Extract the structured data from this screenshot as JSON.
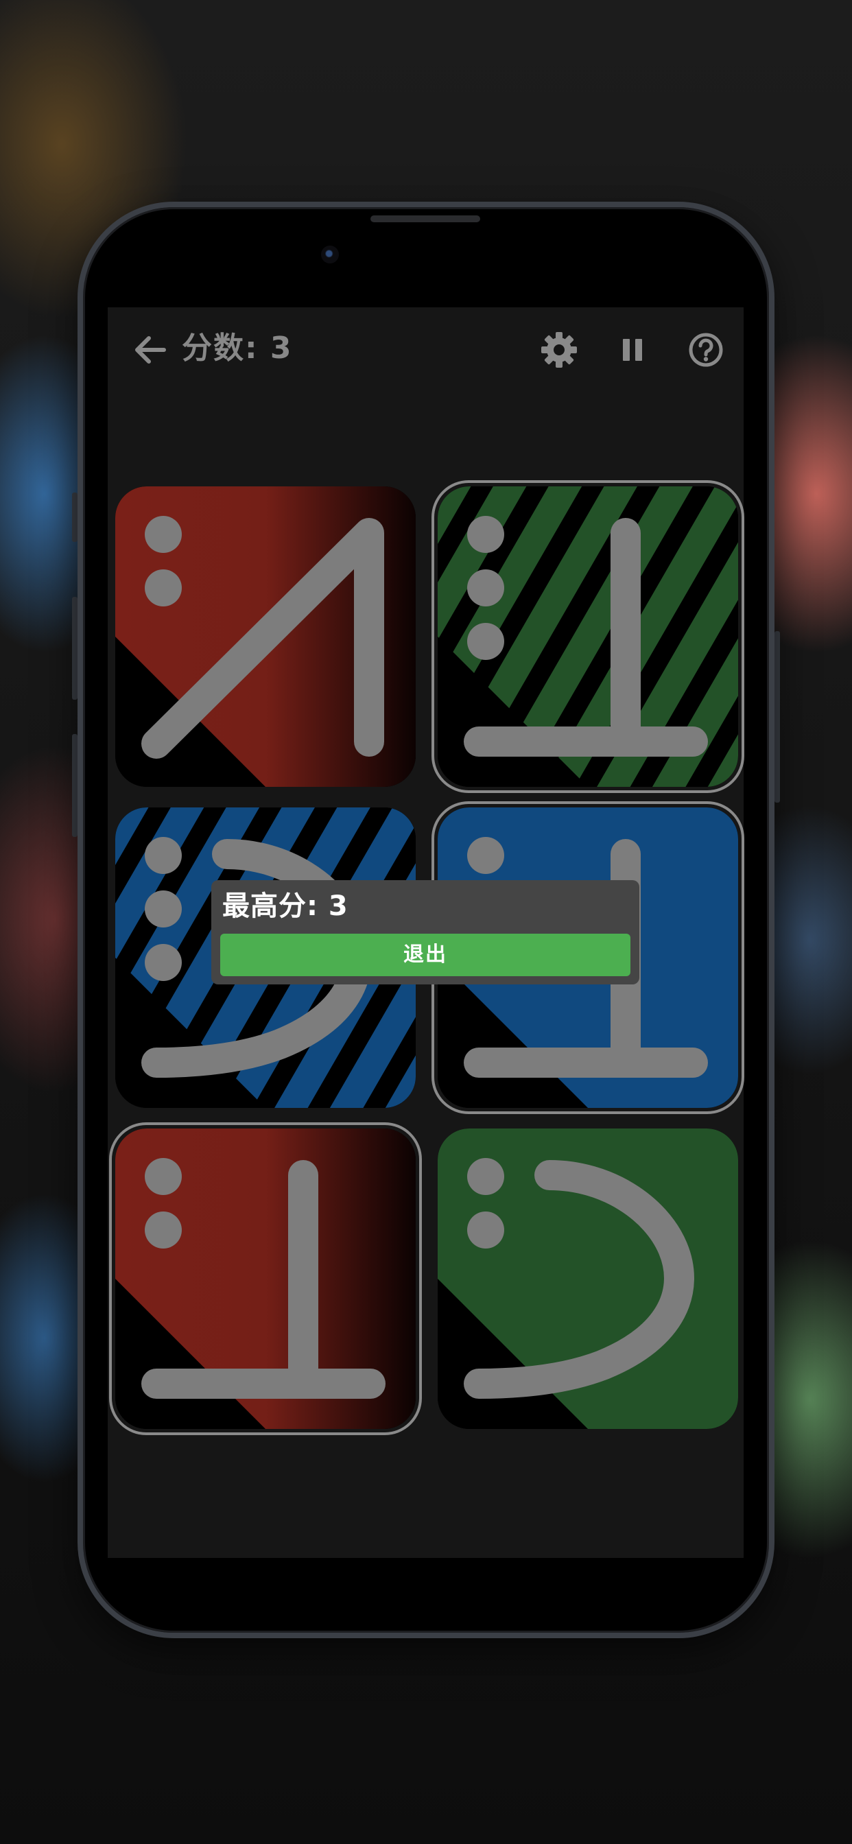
{
  "header": {
    "score_text": "分数: 3",
    "icons": [
      "back-arrow-icon",
      "gear-icon",
      "pause-icon",
      "help-icon"
    ]
  },
  "cards": [
    {
      "row": 1,
      "col": 1,
      "color": "#7a2018",
      "fill": "gradient",
      "dots": 2,
      "symbol": "diagonal-stroke",
      "selected": false
    },
    {
      "row": 1,
      "col": 2,
      "color": "#235228",
      "fill": "stripes",
      "dots": 3,
      "symbol": "inverted-t",
      "selected": true
    },
    {
      "row": 2,
      "col": 1,
      "color": "#10497f",
      "fill": "stripes",
      "dots": 3,
      "symbol": "hook-curve",
      "selected": false
    },
    {
      "row": 2,
      "col": 2,
      "color": "#10497f",
      "fill": "solid",
      "dots": 1,
      "symbol": "inverted-t",
      "selected": true
    },
    {
      "row": 3,
      "col": 1,
      "color": "#7a2018",
      "fill": "gradient",
      "dots": 2,
      "symbol": "inverted-t",
      "selected": true
    },
    {
      "row": 3,
      "col": 2,
      "color": "#235228",
      "fill": "solid",
      "dots": 2,
      "symbol": "hook-curve",
      "selected": false
    }
  ],
  "dialog": {
    "title": "最高分: 3",
    "exit_button": "退出"
  }
}
